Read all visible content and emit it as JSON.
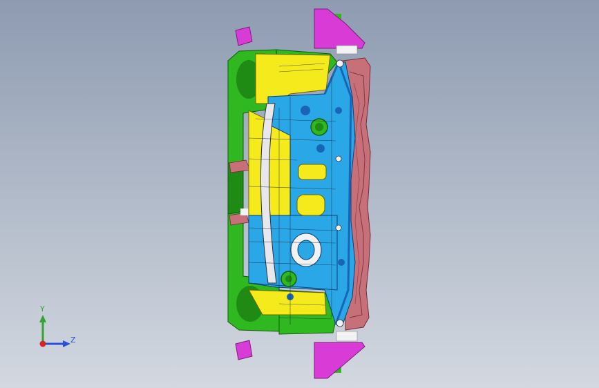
{
  "viewport": {
    "background_top": "#8e9bb1",
    "background_bottom": "#d3d8e0"
  },
  "model": {
    "part_colors": {
      "green": "#2fb81f",
      "dark_green": "#1f8a14",
      "yellow": "#f4ea1c",
      "blue": "#2aa7e6",
      "dark_blue": "#1a64b8",
      "magenta": "#d93bd6",
      "salmon": "#c8707a",
      "white": "#f2f2f2"
    }
  },
  "triad": {
    "y_label": "Y",
    "z_label": "Z",
    "y_color": "#2fa52f",
    "z_color": "#2a4fd8",
    "x_color": "#d42424"
  }
}
